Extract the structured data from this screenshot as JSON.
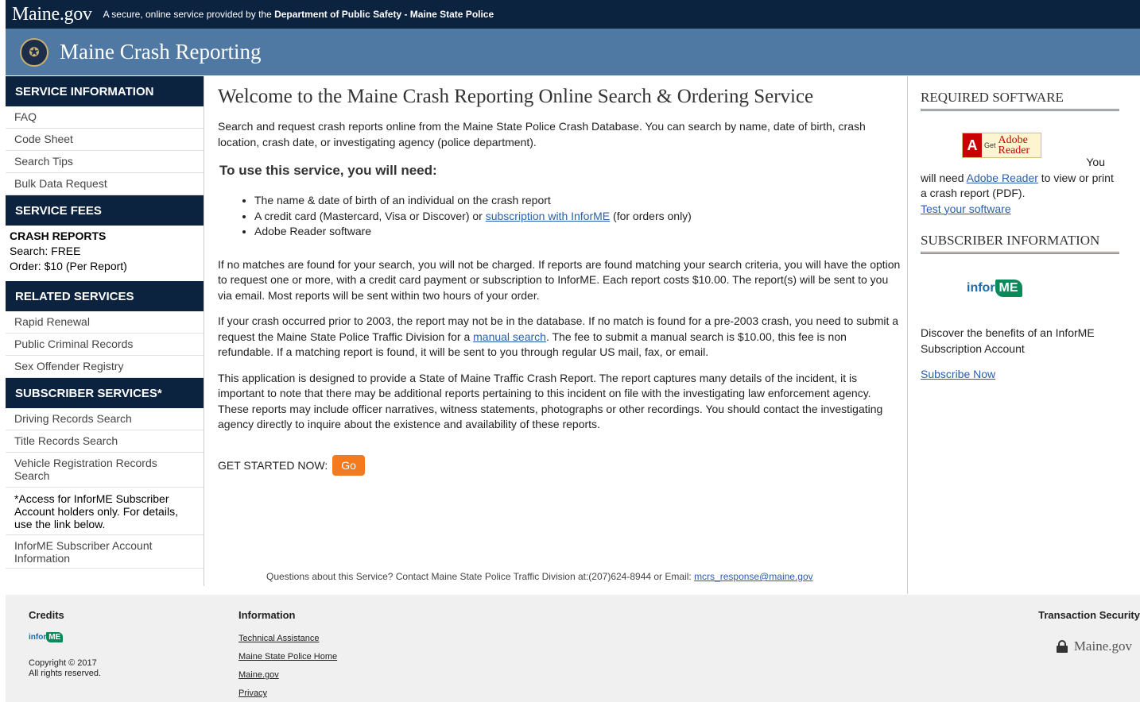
{
  "topbar": {
    "logo": "Maine.gov",
    "tagline_prefix": "A secure, online service provided by the",
    "tagline_dept": "Department of Public Safety - Maine State Police"
  },
  "banner": {
    "title": "Maine Crash Reporting"
  },
  "sidebar": {
    "service_info": {
      "heading": "SERVICE INFORMATION",
      "items": [
        "FAQ",
        "Code Sheet",
        "Search Tips",
        "Bulk Data Request"
      ]
    },
    "service_fees": {
      "heading": "SERVICE FEES",
      "label": "CRASH REPORTS",
      "search": "Search: FREE",
      "order": "Order: $10 (Per Report)"
    },
    "related": {
      "heading": "RELATED SERVICES",
      "items": [
        "Rapid Renewal",
        "Public Criminal Records",
        "Sex Offender Registry"
      ]
    },
    "subscriber": {
      "heading": "SUBSCRIBER SERVICES*",
      "items": [
        "Driving Records Search",
        "Title Records Search",
        "Vehicle Registration Records Search"
      ],
      "note": "*Access for InforME Subscriber Account holders only. For details, use the link below.",
      "account_link": "InforME Subscriber Account Information"
    }
  },
  "main": {
    "heading": "Welcome to the Maine Crash Reporting Online Search & Ordering Service",
    "intro": "Search and request crash reports online from the Maine State Police Crash Database. You can search by name, date of birth, crash location, crash date, or investigating agency (police department).",
    "need_heading": "To use this service, you will need:",
    "need_items": {
      "item1": "The name & date of birth of an individual on the crash report",
      "item2_pre": "A credit card (Mastercard, Visa or Discover) or",
      "item2_link": "subscription with InforME",
      "item2_post": "(for orders only)",
      "item3": "Adobe Reader software"
    },
    "p1": "If no matches are found for your search, you will not be charged. If reports are found matching your search criteria, you will have the option to request one or more, with a credit card payment or subscription to InforME. Each report costs $10.00. The report(s) will be sent to you via email. Most reports will be sent within two hours of your order.",
    "p2_pre": "If your crash occurred prior to 2003, the report may not be in the database. If no match is found for a pre-2003 crash, you need to submit a request the Maine State Police Traffic Division for a",
    "p2_link": "manual search",
    "p2_post": ". The fee to submit a manual search is $10.00, this fee is non refundable. If a matching report is found, it will be sent to you through regular US mail, fax, or email.",
    "p3": "This application is designed to provide a State of Maine Traffic Crash Report. The report captures many details of the incident, it is important to note that there may be additional reports pertaining to this incident on file with the investigating law enforcement agency. These reports may include officer narratives, witness statements, photographs or other recordings. You should contact the investigating agency directly to inquire about the existence and availability of these reports.",
    "get_started": "GET STARTED NOW:",
    "go_label": "Go",
    "contact_pre": "Questions about this Service? Contact Maine State Police Traffic Division at:(207)624-8944 or Email:",
    "contact_email": "mcrs_response@maine.gov"
  },
  "right": {
    "required_heading": "REQUIRED SOFTWARE",
    "adobe_get": "Get",
    "adobe_name1": "Adobe",
    "adobe_name2": "Reader",
    "you": "You",
    "need_pre": "will need",
    "need_link": "Adobe Reader",
    "need_post": "to view or print a crash report (PDF).",
    "test_link": "Test your software",
    "subscriber_heading": "SUBSCRIBER INFORMATION",
    "informe_inf": "infor",
    "informe_me": "ME",
    "discover": "Discover the benefits of an InforME Subscription Account",
    "subscribe_link": "Subscribe Now"
  },
  "footer": {
    "credits_heading": "Credits",
    "credits_inf": "infor",
    "credits_me": "ME",
    "copyright": "Copyright © 2017",
    "rights": "All rights reserved.",
    "info_heading": "Information",
    "info_links": [
      "Technical Assistance",
      "Maine State Police Home",
      "Maine.gov",
      "Privacy"
    ],
    "security_heading": "Transaction Security",
    "security_logo": "Maine.gov"
  },
  "colors": {
    "navy": "#0c2340",
    "banner_blue": "#4f78a2",
    "go_orange": "#f47a20",
    "link_blue": "#2a5db0"
  }
}
